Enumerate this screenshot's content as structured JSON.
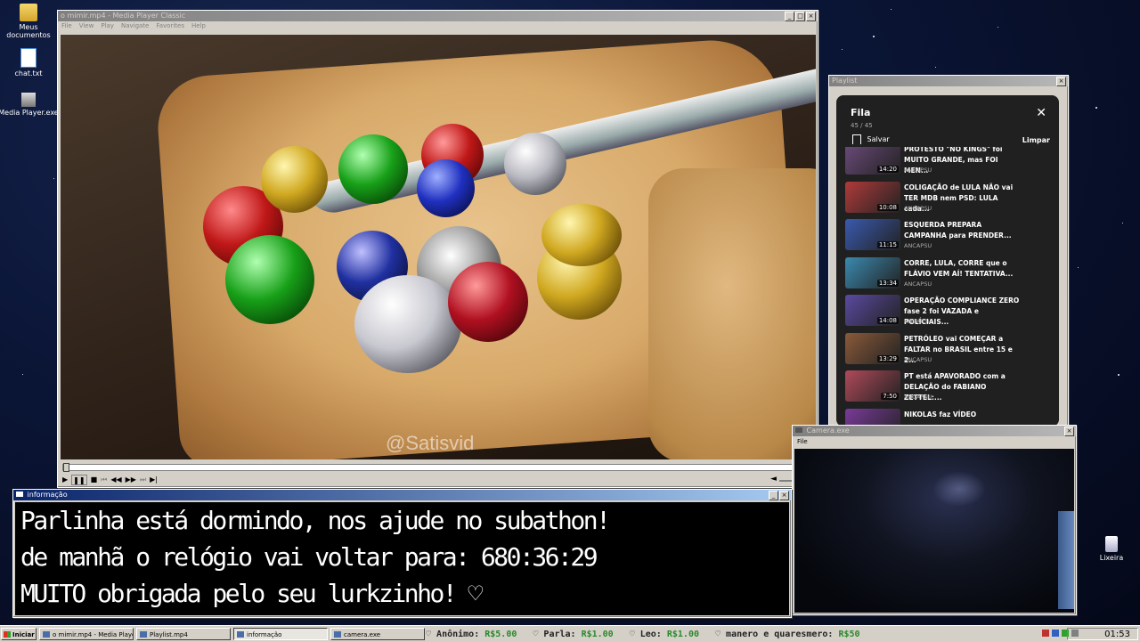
{
  "desktop": {
    "icons": [
      {
        "label": "Meus documentos",
        "icon": "folder-icon"
      },
      {
        "label": "chat.txt",
        "icon": "notepad-icon"
      },
      {
        "label": "Media Player.exe",
        "icon": "media-player-icon"
      },
      {
        "label": "Lixeira",
        "icon": "recycle-bin-icon"
      }
    ]
  },
  "mpc": {
    "title": "o mimir.mp4 - Media Player Classic",
    "menu": [
      "File",
      "View",
      "Play",
      "Navigate",
      "Favorites",
      "Help"
    ],
    "watermark": "@Satisvid",
    "seek_progress": 0.0
  },
  "playlist": {
    "window_title": "Playlist",
    "heading": "Fila",
    "count": "45 / 45",
    "save_label": "Salvar",
    "clear_label": "Limpar",
    "items": [
      {
        "title": "PROTESTO \"NO KINGS\" foi MUITO GRANDE, mas FOI MEN...",
        "channel": "ANCAPSU",
        "duration": "14:20",
        "thumb_color": "#6b4a7a"
      },
      {
        "title": "COLIGAÇÃO de LULA NÃO vai TER MDB nem PSD: LULA cada...",
        "channel": "ANCAPSU",
        "duration": "10:08",
        "thumb_color": "#b03a3a"
      },
      {
        "title": "ESQUERDA PREPARA CAMPANHA para PRENDER...",
        "channel": "ANCAPSU",
        "duration": "11:15",
        "thumb_color": "#3a5ab0"
      },
      {
        "title": "CORRE, LULA, CORRE que o FLÁVIO VEM AÍ! TENTATIVA...",
        "channel": "ANCAPSU",
        "duration": "13:34",
        "thumb_color": "#3a8ab0"
      },
      {
        "title": "OPERAÇÃO COMPLIANCE ZERO fase 2 foi VAZADA e POLÍCIAIS...",
        "channel": "ANCAPSU",
        "duration": "14:08",
        "thumb_color": "#5a4aa0"
      },
      {
        "title": "PETRÓLEO vai COMEÇAR a FALTAR no BRASIL entre 15 e 2...",
        "channel": "ANCAPSU",
        "duration": "13:29",
        "thumb_color": "#8a5a3a"
      },
      {
        "title": "PT está APAVORADO com a DELAÇÃO do FABIANO ZETTEL:...",
        "channel": "ANCAPSU",
        "duration": "7:50",
        "thumb_color": "#b04a5a"
      },
      {
        "title": "NIKOLAS faz VÍDEO",
        "channel": "",
        "duration": "",
        "thumb_color": "#7a3a9a"
      }
    ]
  },
  "info": {
    "title": "informação",
    "lines": [
      "Parlinha está dormindo, nos ajude no subathon!",
      "de manhã o relógio vai voltar para:  680:36:29",
      "MUITO obrigada pelo seu lurkzinho! ♡"
    ]
  },
  "camera": {
    "title": "Camera.exe",
    "menu_file": "File"
  },
  "taskbar": {
    "start_label": "Iniciar",
    "tasks": [
      {
        "label": "o mimir.mp4 - Media Playe...",
        "pressed": false
      },
      {
        "label": "Playlist.mp4",
        "pressed": false
      },
      {
        "label": "informação",
        "pressed": true
      },
      {
        "label": "camera.exe",
        "pressed": false
      }
    ],
    "ticker": [
      {
        "name": "Anônimo:",
        "amount": "R$5.00"
      },
      {
        "name": "Parla:",
        "amount": "R$1.00"
      },
      {
        "name": "Leo:",
        "amount": "R$1.00"
      },
      {
        "name": "manero e quaresmero:",
        "amount": "R$50"
      }
    ],
    "clock": "01:53"
  }
}
